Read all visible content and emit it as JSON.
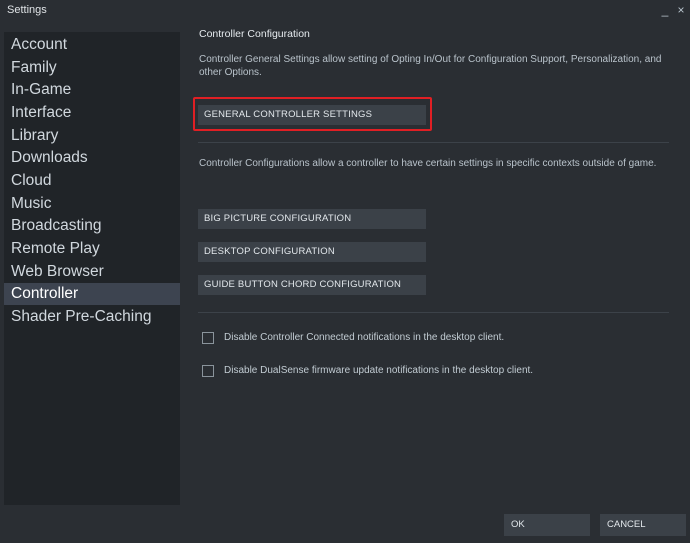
{
  "window": {
    "title": "Settings",
    "minimize_glyph": "_",
    "close_glyph": "×"
  },
  "sidebar": {
    "items": [
      {
        "label": "Account",
        "active": false
      },
      {
        "label": "Family",
        "active": false
      },
      {
        "label": "In-Game",
        "active": false
      },
      {
        "label": "Interface",
        "active": false
      },
      {
        "label": "Library",
        "active": false
      },
      {
        "label": "Downloads",
        "active": false
      },
      {
        "label": "Cloud",
        "active": false
      },
      {
        "label": "Music",
        "active": false
      },
      {
        "label": "Broadcasting",
        "active": false
      },
      {
        "label": "Remote Play",
        "active": false
      },
      {
        "label": "Web Browser",
        "active": false
      },
      {
        "label": "Controller",
        "active": true
      },
      {
        "label": "Shader Pre-Caching",
        "active": false
      }
    ]
  },
  "main": {
    "section_title": "Controller Configuration",
    "general_desc": "Controller General Settings allow setting of Opting In/Out for Configuration Support, Personalization, and other Options.",
    "general_button": "GENERAL CONTROLLER SETTINGS",
    "config_desc": "Controller Configurations allow a controller to have certain settings in specific contexts outside of game.",
    "config_buttons": [
      "BIG PICTURE CONFIGURATION",
      "DESKTOP CONFIGURATION",
      "GUIDE BUTTON CHORD CONFIGURATION"
    ],
    "checkboxes": [
      {
        "label": "Disable Controller Connected notifications in the desktop client.",
        "checked": false
      },
      {
        "label": "Disable DualSense firmware update notifications in the desktop client.",
        "checked": false
      }
    ]
  },
  "footer": {
    "ok_label": "OK",
    "cancel_label": "CANCEL"
  },
  "colors": {
    "background": "#2a2e33",
    "sidebar": "#202428",
    "active_item": "#3d4450",
    "button": "#3b4148",
    "highlight": "#e01f24"
  }
}
